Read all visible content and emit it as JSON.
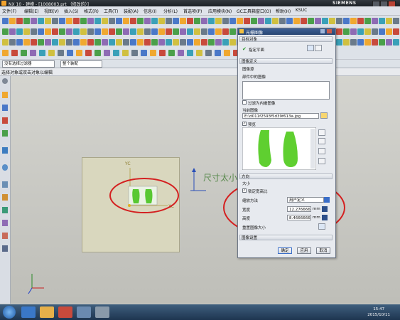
{
  "titlebar": {
    "title": "NX 10 - 建模 - [1008003.prt （修改的）]",
    "brand": "SIEMENS"
  },
  "menubar": {
    "items": [
      "文件(F)",
      "编辑(E)",
      "视图(V)",
      "插入(S)",
      "格式(R)",
      "工具(T)",
      "装配(A)",
      "信息(I)",
      "分析(L)",
      "首选项(P)",
      "应用模块(N)",
      "GC工具箱",
      "窗口(O)",
      "帮助(H)",
      "KSUC"
    ]
  },
  "selection_bar": {
    "filter": "没有选择过滤器",
    "scope": "整个装配"
  },
  "cue_line": "选择对象或双击对象以编辑",
  "dialog": {
    "title": "光栅图像",
    "target_section": "目标对象",
    "target_value": "指定平面",
    "image_def_section": "图像定义",
    "image_source": "图像源",
    "image_in_part": "部件中的图像",
    "filter_local": "过滤为内嵌图像",
    "current_image_label": "当前图像",
    "current_image_value": "E:\\d011f2593f5d39f613a.jpg",
    "preview_label": "预览",
    "orientation_section": "方向",
    "size_section": "大小",
    "lock_aspect": "锁定宽高比",
    "scale_method_label": "缩放方法",
    "scale_method_value": "用户定义",
    "width_label": "宽度",
    "width_value": "12.2766666",
    "width_unit": "mm",
    "height_label": "高度",
    "height_value": "8.4666666",
    "height_unit": "mm",
    "reset_size": "重置图像大小",
    "settings_section": "图像设置",
    "ok": "确定",
    "apply": "应用",
    "cancel": "取消"
  },
  "annotation": "尺寸太小，与实际产品尺寸不符合。",
  "viewport": {
    "yc_label": "YC",
    "xc_label": "XC"
  },
  "clock": {
    "time": "15:47",
    "date": "2015/10/11"
  },
  "colors": {
    "annotation": "#5a8a4e",
    "highlight_circle": "#d42020",
    "dialog_title": "#2f4f80"
  }
}
